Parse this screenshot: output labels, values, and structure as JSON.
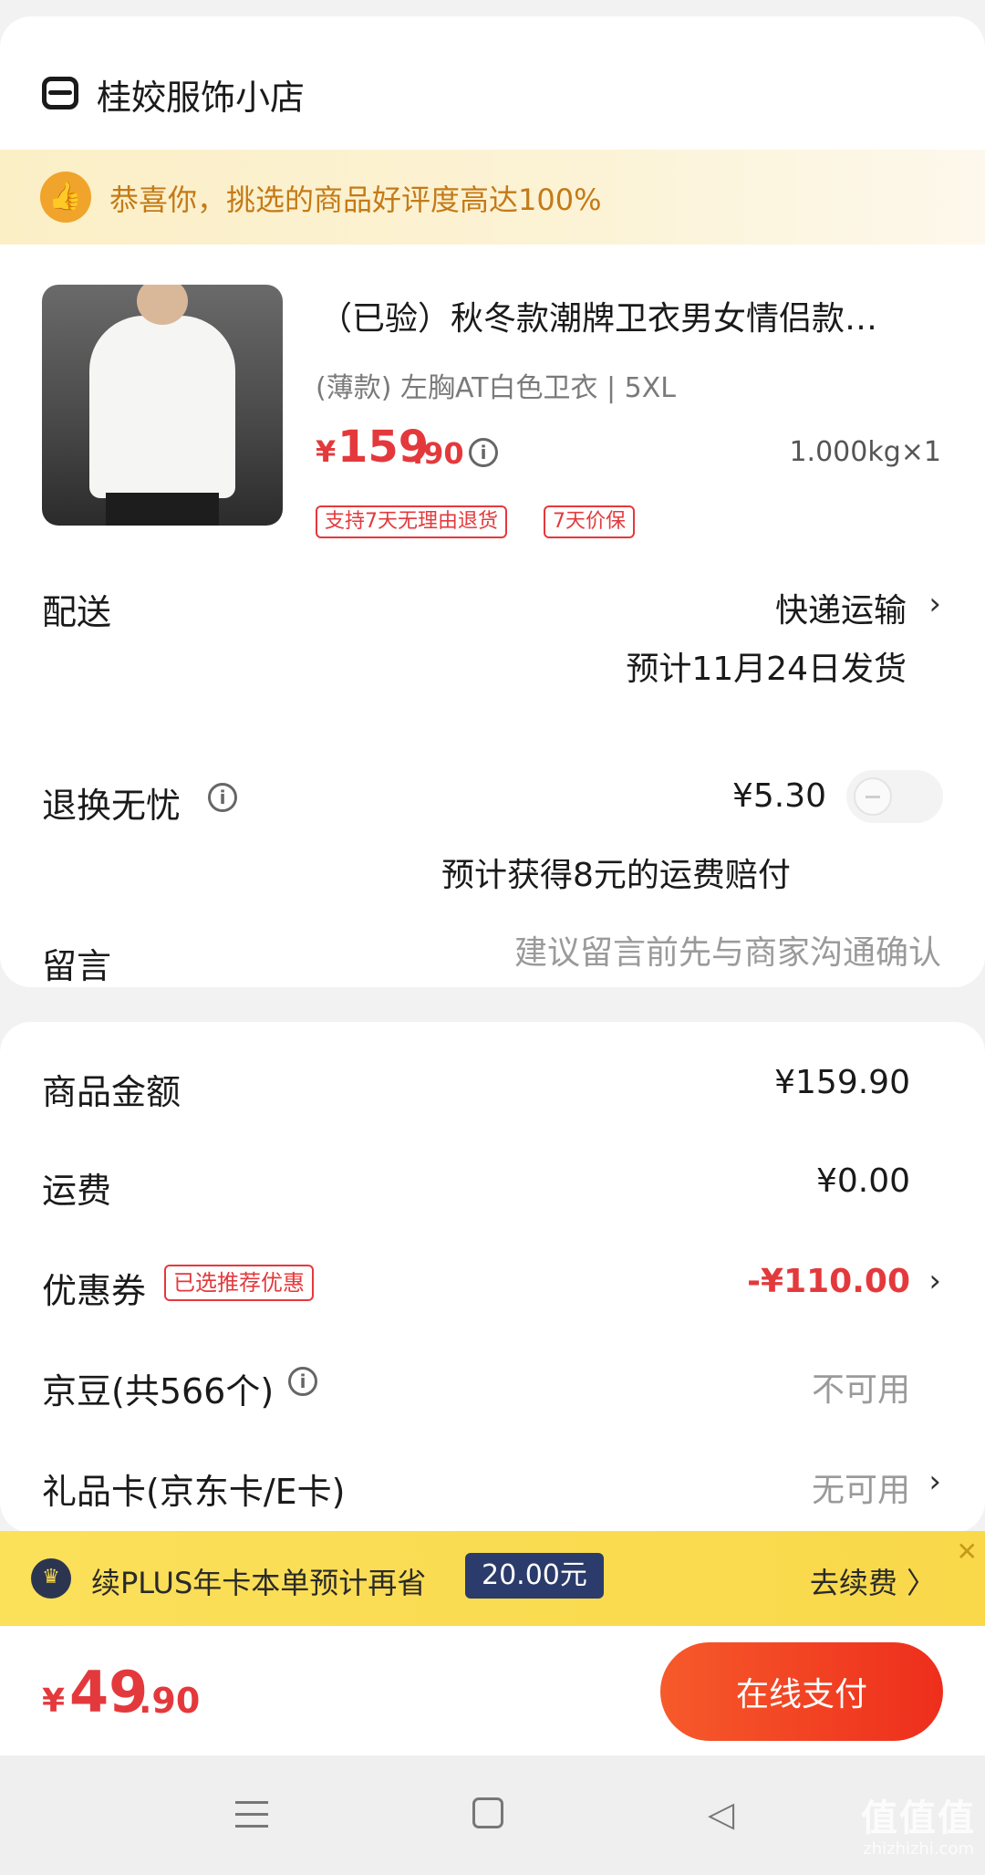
{
  "store": {
    "name": "桂姣服饰小店",
    "icon": "store-icon"
  },
  "banner": {
    "text": "恭喜你，挑选的商品好评度高达100%",
    "icon": "thumbs-up-icon"
  },
  "product": {
    "title": "（已验）秋冬款潮牌卫衣男女情侣款…",
    "spec": "(薄款) 左胸AT白色卫衣 | 5XL",
    "price_symbol": "¥",
    "price_int": "159",
    "price_dec": ".90",
    "weight_qty": "1.000kg×1",
    "tags": [
      "支持7天无理由退货",
      "7天价保"
    ]
  },
  "delivery": {
    "label": "配送",
    "method": "快递运输",
    "estimate": "预计11月24日发货"
  },
  "return_service": {
    "label": "退换无忧",
    "price": "¥5.30",
    "enabled": false,
    "note": "预计获得8元的运费赔付"
  },
  "message": {
    "label": "留言",
    "placeholder": "建议留言前先与商家沟通确认"
  },
  "summary": {
    "goods": {
      "label": "商品金额",
      "value": "¥159.90"
    },
    "shipping": {
      "label": "运费",
      "value": "¥0.00"
    },
    "coupon": {
      "label": "优惠券",
      "tag": "已选推荐优惠",
      "value": "-¥110.00"
    },
    "beans": {
      "label": "京豆(共566个)",
      "value": "不可用"
    },
    "gift_card": {
      "label": "礼品卡(京东卡/E卡)",
      "value": "无可用"
    }
  },
  "plus": {
    "text": "续PLUS年卡本单预计再省",
    "badge": "20.00元",
    "cta": "去续费 〉",
    "close": "✕"
  },
  "pay": {
    "total_symbol": "¥",
    "total_int": "49",
    "total_dec": ".90",
    "button": "在线支付"
  },
  "watermark": {
    "main": "值值值",
    "sub": "zhizhizhi.com"
  },
  "colors": {
    "accent": "#e4393c",
    "plus_yellow": "#f9d84a",
    "banner_text": "#c47a17"
  }
}
